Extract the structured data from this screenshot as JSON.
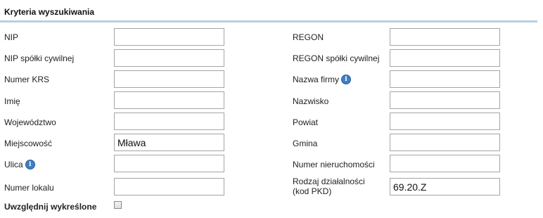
{
  "section": {
    "title": "Kryteria wyszukiwania"
  },
  "fields": {
    "nip": {
      "label": "NIP",
      "value": ""
    },
    "nip_spolki": {
      "label": "NIP spółki cywilnej",
      "value": ""
    },
    "numer_krs": {
      "label": "Numer KRS",
      "value": ""
    },
    "imie": {
      "label": "Imię",
      "value": ""
    },
    "wojewodztwo": {
      "label": "Województwo",
      "value": ""
    },
    "miejscowosc": {
      "label": "Miejscowość",
      "value": "Mława"
    },
    "ulica": {
      "label": "Ulica",
      "value": "",
      "has_info_icon": true
    },
    "numer_lokalu": {
      "label": "Numer lokalu",
      "value": ""
    },
    "regon": {
      "label": "REGON",
      "value": ""
    },
    "regon_spolki": {
      "label": "REGON spółki cywilnej",
      "value": ""
    },
    "nazwa_firmy": {
      "label": "Nazwa firmy",
      "value": "",
      "has_info_icon": true
    },
    "nazwisko": {
      "label": "Nazwisko",
      "value": ""
    },
    "powiat": {
      "label": "Powiat",
      "value": ""
    },
    "gmina": {
      "label": "Gmina",
      "value": ""
    },
    "numer_nieruchomosci": {
      "label": "Numer nieruchomości",
      "value": ""
    },
    "rodzaj_dzialalnosci": {
      "label_line1": "Rodzaj działalności",
      "label_line2": "(kod PKD)",
      "value": "69.20.Z"
    }
  },
  "include_deleted": {
    "label": "Uwzględnij wykreślone",
    "checked": false
  },
  "icons": {
    "info": "i"
  },
  "colors": {
    "rule": "#b7cfe3",
    "info_icon": "#3f7fc4",
    "input_border": "#a5a5a5"
  }
}
